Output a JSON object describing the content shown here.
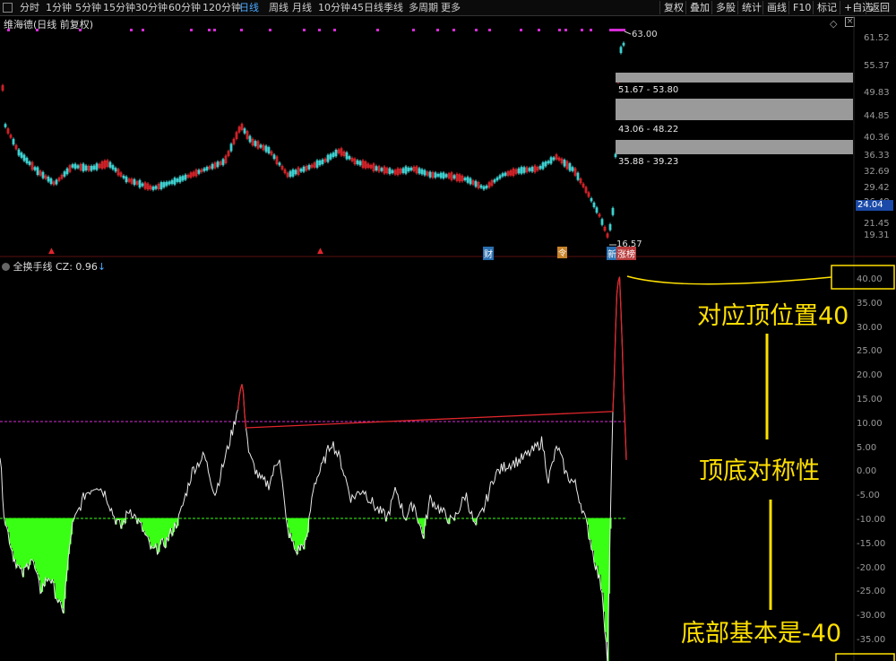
{
  "toolbar": {
    "timeframes": [
      "分时",
      "1分钟",
      "5分钟",
      "15分钟",
      "30分钟",
      "60分钟",
      "120分钟",
      "日线",
      "周线",
      "月线",
      "10分钟",
      "45日线",
      "季线",
      "多周期",
      "更多"
    ],
    "active_index": 7,
    "right_buttons": [
      "复权",
      "叠加",
      "多股",
      "统计",
      "画线",
      "F10",
      "标记",
      "+自选",
      "返回"
    ]
  },
  "chart_title": "维海德(日线 前复权)",
  "indicator": {
    "name": "全换手线",
    "label": "CZ: 0.96",
    "arrow": "↓"
  },
  "price_axis": [
    "61.52",
    "55.37",
    "49.83",
    "44.85",
    "40.36",
    "36.33",
    "32.69",
    "29.42",
    "26.48",
    "21.45",
    "19.31"
  ],
  "current_price": "24.04",
  "high_mark": "63.00",
  "low_mark": "16.57",
  "ranges": [
    "51.67 - 53.80",
    "43.06 - 48.22",
    "35.88 - 39.23"
  ],
  "indicator_axis": [
    "40.00",
    "35.00",
    "30.00",
    "25.00",
    "20.00",
    "15.00",
    "10.00",
    "5.00",
    "0.00",
    "-5.00",
    "-10.00",
    "-15.00",
    "-20.00",
    "-25.00",
    "-30.00",
    "-35.00"
  ],
  "markers": {
    "cai": "财",
    "ling": "令",
    "xin": "新",
    "zhang": "涨榜"
  },
  "annotations": {
    "top": "对应顶位置40",
    "mid": "顶底对称性",
    "bottom": "底部基本是-40"
  },
  "colors": {
    "green": "#39ff14",
    "magenta": "#d62cd6",
    "red": "#e0262c",
    "cyan": "#3fd0d0",
    "yellow": "#ffe000"
  }
}
